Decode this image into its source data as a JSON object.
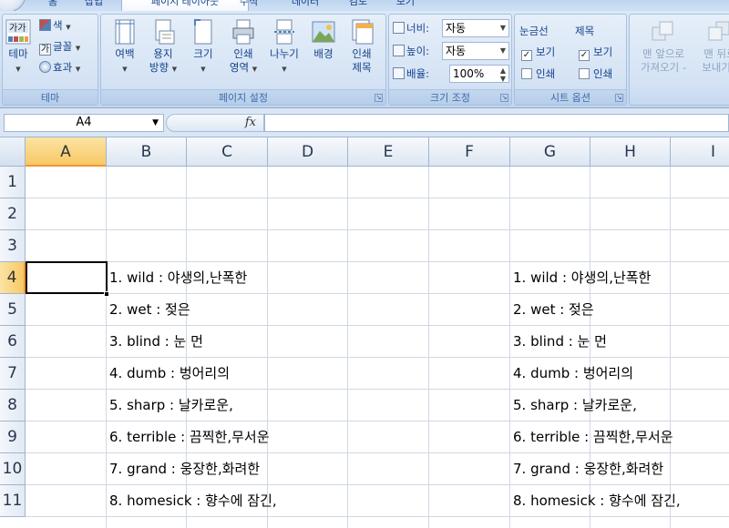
{
  "tabs": [
    "홈",
    "삽입",
    "페이지 레이아웃",
    "수식",
    "데이터",
    "검토",
    "보기"
  ],
  "ribbon": {
    "theme_group": {
      "label": "테마",
      "theme_btn": "테마",
      "colors": "색",
      "fonts": "글꼴",
      "effects": "효과"
    },
    "page_setup": {
      "label": "페이지 설정",
      "margins": "여백",
      "orientation": "용지 방향",
      "orientation_l1": "용지",
      "orientation_l2": "방향",
      "size": "크기",
      "print_area_l1": "인쇄",
      "print_area_l2": "영역",
      "breaks": "나누기",
      "background": "배경",
      "print_titles_l1": "인쇄",
      "print_titles_l2": "제목"
    },
    "scale": {
      "label": "크기 조정",
      "width_label": "너비:",
      "width_value": "자동",
      "height_label": "높이:",
      "height_value": "자동",
      "scale_label": "배율:",
      "scale_value": "100%"
    },
    "sheet_options": {
      "label": "시트 옵션",
      "gridlines": "눈금선",
      "headings": "제목",
      "view": "보기",
      "print": "인쇄",
      "gridlines_view_checked": true,
      "gridlines_print_checked": false,
      "headings_view_checked": true,
      "headings_print_checked": false
    },
    "arrange": {
      "bring_front_l1": "맨 앞으로",
      "bring_front_l2": "가져오기 -",
      "send_back_l1": "맨 뒤로",
      "send_back_l2": "보내기 -"
    }
  },
  "formula_bar": {
    "name_box": "A4",
    "fx": "fx",
    "content": ""
  },
  "columns": [
    "A",
    "B",
    "C",
    "D",
    "E",
    "F",
    "G",
    "H",
    "I"
  ],
  "selected_column": "A",
  "rows": [
    "1",
    "2",
    "3",
    "4",
    "5",
    "6",
    "7",
    "8",
    "9",
    "10",
    "11"
  ],
  "selected_row": "4",
  "cells": {
    "B": [
      "",
      "",
      "",
      "1. wild : 야생의,난폭한",
      "2. wet : 젖은",
      "3. blind : 눈 먼",
      "4. dumb : 벙어리의",
      "5. sharp : 날카로운,",
      "6. terrible : 끔찍한,무서운",
      "7. grand : 웅장한,화려한",
      "8. homesick : 향수에 잠긴,"
    ],
    "G": [
      "",
      "",
      "",
      "1. wild : 야생의,난폭한",
      "2. wet : 젖은",
      "3. blind : 눈 먼",
      "4. dumb : 벙어리의",
      "5. sharp : 날카로운,",
      "6. terrible : 끔찍한,무서운",
      "7. grand : 웅장한,화려한",
      "8. homesick : 향수에 잠긴,"
    ]
  }
}
